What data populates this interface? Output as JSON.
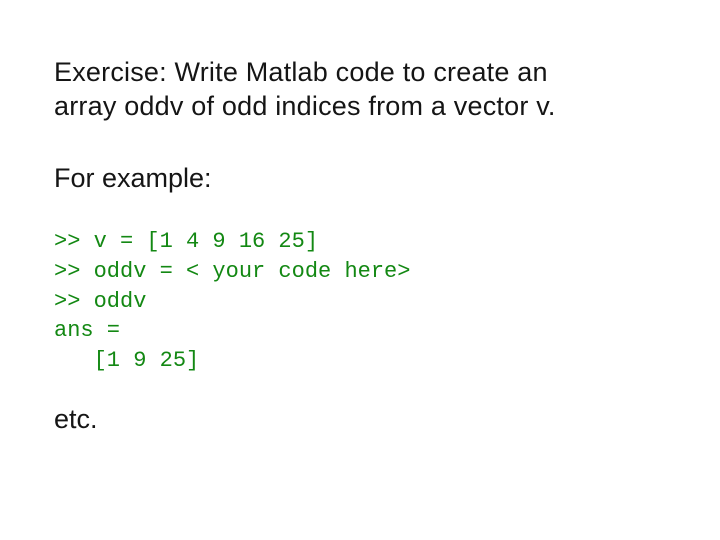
{
  "title": "Exercise: Write Matlab code to create an array oddv of odd indices from a vector v.",
  "subtitle": "For example:",
  "code_lines": [
    ">> v = [1 4 9 16 25]",
    ">> oddv = < your code here>",
    ">> oddv",
    "ans =",
    "   [1 9 25]"
  ],
  "etc": "etc.",
  "colors": {
    "code_green": "#138813",
    "text": "#151515"
  }
}
